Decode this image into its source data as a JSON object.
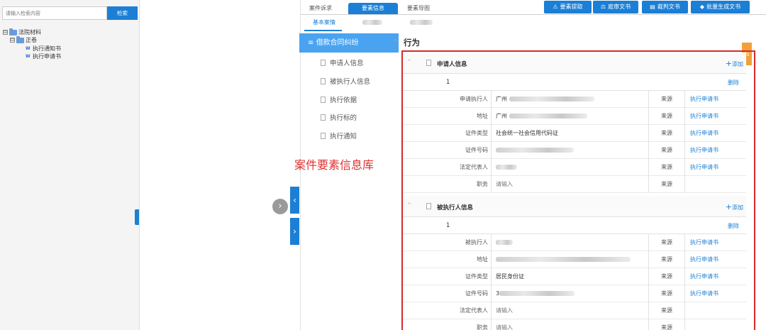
{
  "left": {
    "search_placeholder": "请输入检索内容",
    "search_button": "检索",
    "tree": [
      {
        "label": "法院材料",
        "toggle": "⊟",
        "kind": "folder"
      },
      {
        "label": "正卷",
        "toggle": "⊟",
        "kind": "folder"
      },
      {
        "label": "执行通知书",
        "kind": "word"
      },
      {
        "label": "执行申请书",
        "kind": "word"
      }
    ]
  },
  "tabs": [
    "案件诉求",
    "要素信息",
    "要素导图"
  ],
  "toolbar": [
    {
      "icon": "⚠",
      "label": "要素提取"
    },
    {
      "icon": "⚖",
      "label": "庭审文书"
    },
    {
      "icon": "▤",
      "label": "裁判文书"
    },
    {
      "icon": "◆",
      "label": "批量生成文书"
    }
  ],
  "subtabs": [
    "基本案情"
  ],
  "category": {
    "header": "借款合同纠纷",
    "items": [
      "申请人信息",
      "被执行人信息",
      "执行依据",
      "执行标的",
      "执行通知"
    ]
  },
  "section_title": "行为",
  "annotation": "案件要素信息库",
  "orange_tab": "右",
  "groups": [
    {
      "title": "申请人信息",
      "add": "添加",
      "index": "1",
      "delete": "删除",
      "rows": [
        {
          "label": "申请执行人",
          "value": "广州",
          "source": "来源",
          "link": "执行申请书"
        },
        {
          "label": "地址",
          "value": "广州",
          "source": "来源",
          "link": "执行申请书"
        },
        {
          "label": "证件类型",
          "value": "社会统一社会信用代码证",
          "source": "来源",
          "link": "执行申请书"
        },
        {
          "label": "证件号码",
          "value": "",
          "source": "来源",
          "link": "执行申请书"
        },
        {
          "label": "法定代表人",
          "value": "",
          "source": "来源",
          "link": "执行申请书"
        },
        {
          "label": "职务",
          "value": "请输入",
          "source": "来源",
          "link": ""
        }
      ]
    },
    {
      "title": "被执行人信息",
      "add": "添加",
      "index": "1",
      "delete": "删除",
      "rows": [
        {
          "label": "被执行人",
          "value": "",
          "source": "来源",
          "link": "执行申请书"
        },
        {
          "label": "地址",
          "value": "",
          "source": "来源",
          "link": "执行申请书"
        },
        {
          "label": "证件类型",
          "value": "居民身份证",
          "source": "来源",
          "link": "执行申请书"
        },
        {
          "label": "证件号码",
          "value": "3",
          "source": "来源",
          "link": "执行申请书"
        },
        {
          "label": "法定代表人",
          "value": "请输入",
          "source": "来源",
          "link": ""
        },
        {
          "label": "职务",
          "value": "请输入",
          "source": "来源",
          "link": ""
        }
      ]
    }
  ]
}
